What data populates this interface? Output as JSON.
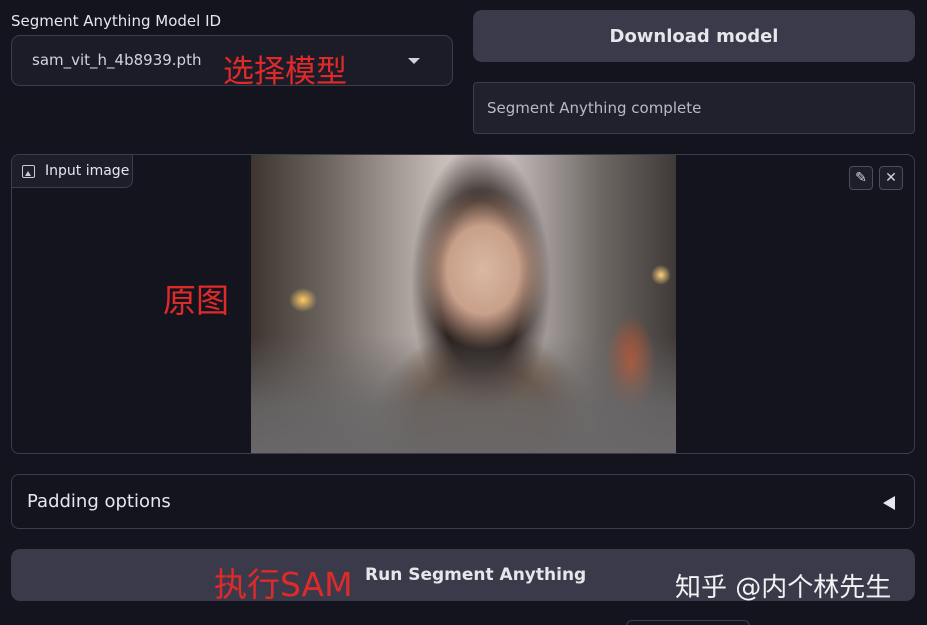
{
  "model": {
    "label": "Segment Anything Model ID",
    "selected": "sam_vit_h_4b8939.pth"
  },
  "download": {
    "button_label": "Download model",
    "status": "Segment Anything complete"
  },
  "image_panel": {
    "tag_label": "Input image",
    "edit_icon": "pencil-icon",
    "close_icon": "close-icon"
  },
  "padding": {
    "label": "Padding options",
    "caret_icon": "triangle-left-icon"
  },
  "run": {
    "button_label": "Run Segment Anything"
  },
  "annotations": {
    "model_note": "选择模型",
    "image_note": "原图",
    "run_note": "执行SAM",
    "watermark": "知乎 @内个林先生"
  },
  "colors": {
    "background": "#14141f",
    "button": "#3a3a4a",
    "annotation": "#e02a2a"
  }
}
